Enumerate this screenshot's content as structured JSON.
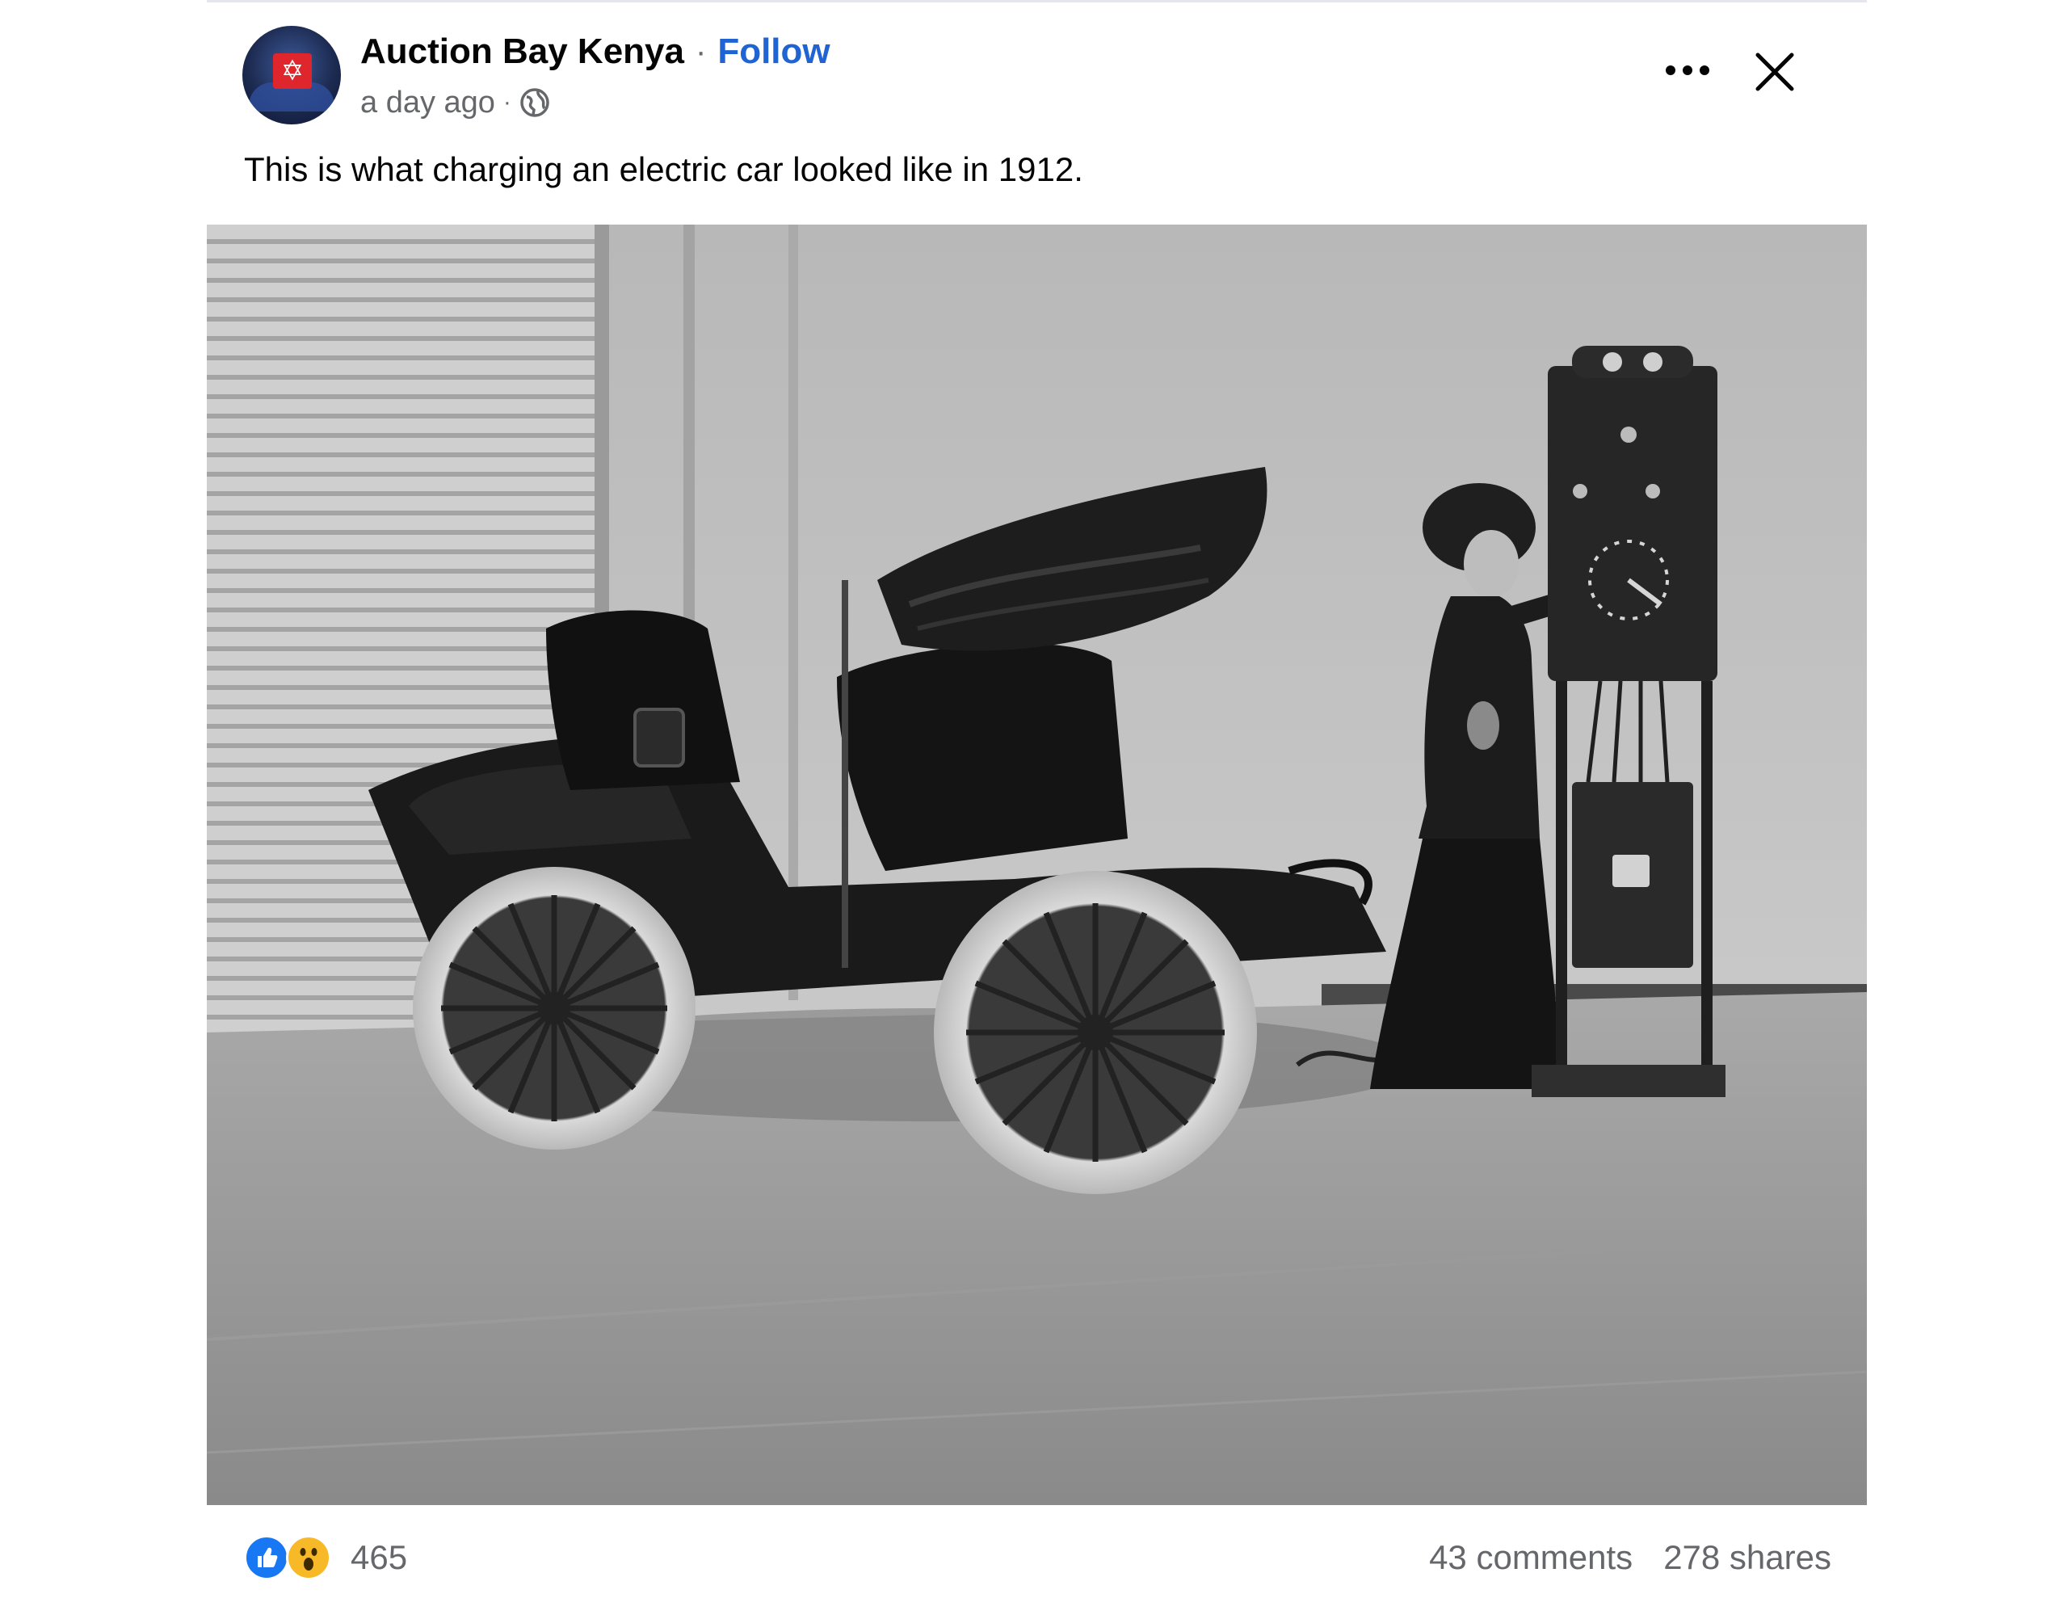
{
  "post": {
    "page_name": "Auction Bay Kenya",
    "separator": "·",
    "follow_label": "Follow",
    "timestamp": "a day ago",
    "meta_separator": "·",
    "audience_icon": "globe-icon",
    "more_icon": "more-horizontal-icon",
    "close_icon": "close-icon",
    "avatar_icon": "auction-bay-logo",
    "caption": "This is what charging an electric car looked like in 1912."
  },
  "photo": {
    "content": "black-and-white photograph of a woman beside an early electric car and a charging panel"
  },
  "footer": {
    "reaction_icons": [
      "like-icon",
      "wow-icon"
    ],
    "reaction_count": "465",
    "comments": "43 comments",
    "shares": "278 shares"
  },
  "colors": {
    "follow": "#1f64d2",
    "muted_text": "#65676b",
    "like": "#1877f2",
    "wow": "#f7b928"
  }
}
